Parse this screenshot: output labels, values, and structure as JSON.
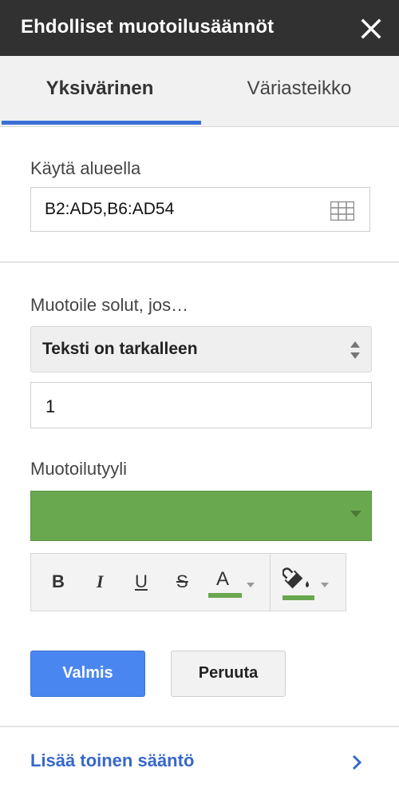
{
  "header": {
    "title": "Ehdolliset muotoilusäännöt",
    "close_icon": "close-icon"
  },
  "tabs": [
    {
      "label": "Yksivärinen",
      "active": true
    },
    {
      "label": "Väriasteikko",
      "active": false
    }
  ],
  "range": {
    "label": "Käytä alueella",
    "value": "B2:AD5,B6:AD54",
    "icon": "grid-select-icon"
  },
  "condition": {
    "label": "Muotoile solut, jos…",
    "selected": "Teksti on tarkalleen",
    "value": "1"
  },
  "format_style": {
    "label": "Muotoilutyyli",
    "swatch_color": "#6aa84f",
    "toolbar": {
      "bold": "B",
      "italic": "I",
      "underline": "U",
      "strikethrough": "S",
      "text_color": "A",
      "text_color_bar": "#6aa84f",
      "fill_color_bar": "#6aa84f"
    }
  },
  "actions": {
    "done_label": "Valmis",
    "cancel_label": "Peruuta",
    "done_color": "#4a86f0"
  },
  "footer": {
    "add_rule_label": "Lisää toinen sääntö"
  }
}
